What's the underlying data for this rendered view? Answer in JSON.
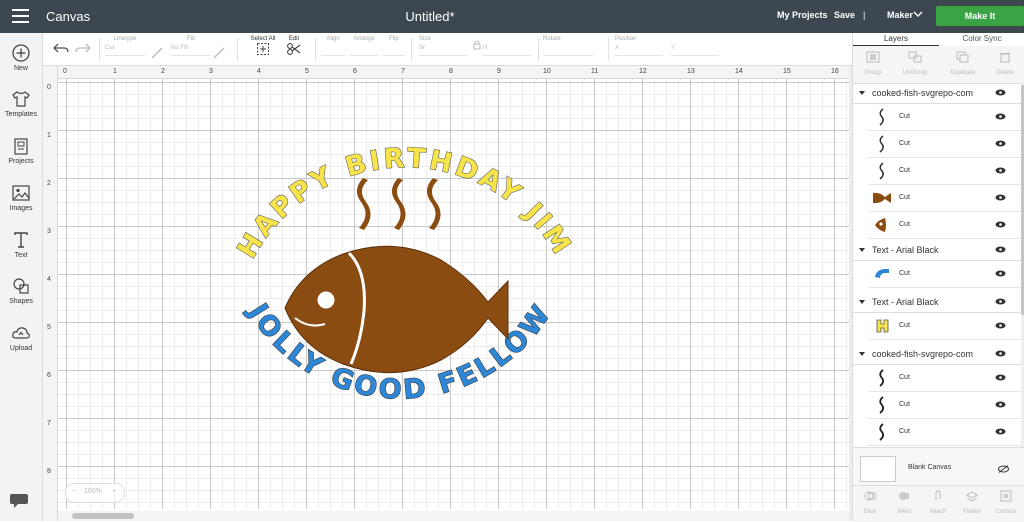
{
  "topbar": {
    "app_title": "Canvas",
    "doc_title": "Untitled*",
    "my_projects": "My Projects",
    "save": "Save",
    "separator": "|",
    "maker": "Maker",
    "make_it": "Make It"
  },
  "sidebar": {
    "items": [
      {
        "label": "New",
        "icon": "plus-circle-icon"
      },
      {
        "label": "Templates",
        "icon": "tshirt-icon"
      },
      {
        "label": "Projects",
        "icon": "projects-icon"
      },
      {
        "label": "Images",
        "icon": "image-icon"
      },
      {
        "label": "Text",
        "icon": "text-icon"
      },
      {
        "label": "Shapes",
        "icon": "shapes-icon"
      },
      {
        "label": "Upload",
        "icon": "upload-icon"
      }
    ]
  },
  "toolbar": {
    "linetype": "Linetype",
    "linetype_value": "Cut",
    "fill": "Fill",
    "fill_value": "No Fill",
    "select_all": "Select All",
    "edit": "Edit",
    "align": "Align",
    "arrange": "Arrange",
    "flip": "Flip",
    "size": "Size",
    "size_w": "W",
    "size_h": "H",
    "rotate": "Rotate",
    "position": "Position",
    "pos_x": "X",
    "pos_y": "Y"
  },
  "canvas": {
    "ruler_top": [
      "0",
      "1",
      "2",
      "3",
      "4",
      "5",
      "6",
      "7",
      "8",
      "9",
      "10",
      "11",
      "12",
      "13",
      "14",
      "15",
      "16"
    ],
    "ruler_left": [
      "0",
      "1",
      "2",
      "3",
      "4",
      "5",
      "6",
      "7",
      "8"
    ],
    "top_text": "HAPPY BIRTHDAY JIM",
    "bottom_text": "JOLLY GOOD FELLOW",
    "zoom": "100%",
    "colors": {
      "yellow": "#f7e34a",
      "blue": "#2d86d6",
      "brown": "#8b4c11"
    }
  },
  "panel": {
    "tabs": [
      "Layers",
      "Color Sync"
    ],
    "tools": [
      "Group",
      "UnGroup",
      "Duplicate",
      "Delete"
    ],
    "groups": [
      {
        "name": "cooked-fish-svgrepo-com",
        "layers": [
          "Cut",
          "Cut",
          "Cut",
          "Cut",
          "Cut"
        ]
      },
      {
        "name": "Text - Arial Black",
        "layers": [
          "Cut"
        ]
      },
      {
        "name": "Text - Arial Black",
        "layers": [
          "Cut"
        ]
      },
      {
        "name": "cooked-fish-svgrepo-com",
        "layers": [
          "Cut",
          "Cut",
          "Cut"
        ]
      }
    ],
    "blank_canvas": "Blank Canvas",
    "bottom_tools": [
      "Slice",
      "Weld",
      "Attach",
      "Flatten",
      "Contour"
    ]
  }
}
